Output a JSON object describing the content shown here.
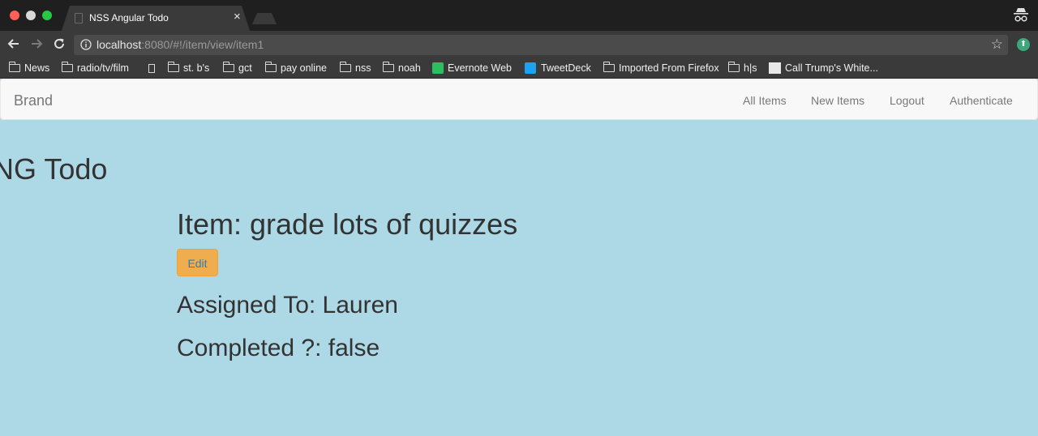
{
  "browser": {
    "tab_title": "NSS Angular Todo",
    "tab_close": "×",
    "url_host": "localhost",
    "url_rest": ":8080/#!/item/view/item1",
    "bookmarks": [
      {
        "label": "News",
        "icon": "folder-icon"
      },
      {
        "label": "radio/tv/film",
        "icon": "folder-icon"
      },
      {
        "label": "",
        "icon": "page-icon"
      },
      {
        "label": "st. b's",
        "icon": "folder-icon"
      },
      {
        "label": "gct",
        "icon": "folder-icon"
      },
      {
        "label": "pay online",
        "icon": "folder-icon"
      },
      {
        "label": "nss",
        "icon": "folder-icon"
      },
      {
        "label": "noah",
        "icon": "folder-icon"
      },
      {
        "label": "Evernote Web",
        "icon": "evernote-icon"
      },
      {
        "label": "TweetDeck",
        "icon": "tweetdeck-icon"
      },
      {
        "label": "Imported From Firefox",
        "icon": "folder-icon"
      },
      {
        "label": "h|s",
        "icon": "folder-icon"
      },
      {
        "label": "Call Trump's White...",
        "icon": "white-house-icon"
      }
    ]
  },
  "navbar": {
    "brand": "Brand",
    "links": [
      "All Items",
      "New Items",
      "Logout",
      "Authenticate"
    ]
  },
  "page": {
    "app_title": "NG Todo",
    "item_title": "Item: grade lots of quizzes",
    "edit_label": "Edit",
    "assigned": "Assigned To: Lauren",
    "completed": "Completed ?: false"
  },
  "colors": {
    "page_background": "#add8e6",
    "edit_button": "#f0ad4e",
    "navbar_background": "#f8f8f8"
  }
}
